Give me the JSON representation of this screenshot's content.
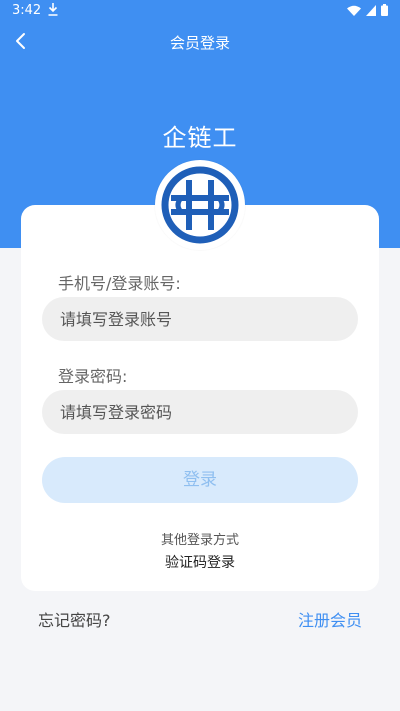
{
  "status_bar": {
    "time": "3:42",
    "icons": [
      "download-icon",
      "wifi-icon",
      "signal-icon",
      "battery-icon"
    ]
  },
  "nav": {
    "title": "会员登录",
    "back_icon": "chevron-left-icon"
  },
  "brand": {
    "name": "企链工",
    "logo_icon": "company-logo"
  },
  "form": {
    "phone_label": "手机号/登录账号:",
    "phone_placeholder": "请填写登录账号",
    "password_label": "登录密码:",
    "password_placeholder": "请填写登录密码",
    "login_button": "登录"
  },
  "alt_login": {
    "title": "其他登录方式",
    "sms_login": "验证码登录"
  },
  "footer": {
    "forgot_password": "忘记密码?",
    "register": "注册会员"
  },
  "colors": {
    "primary": "#3f8ff2",
    "background": "#f4f5f8",
    "login_button_bg": "#d8eafc",
    "login_button_text": "#8fbff0",
    "logo_blue": "#1f5fb8"
  }
}
